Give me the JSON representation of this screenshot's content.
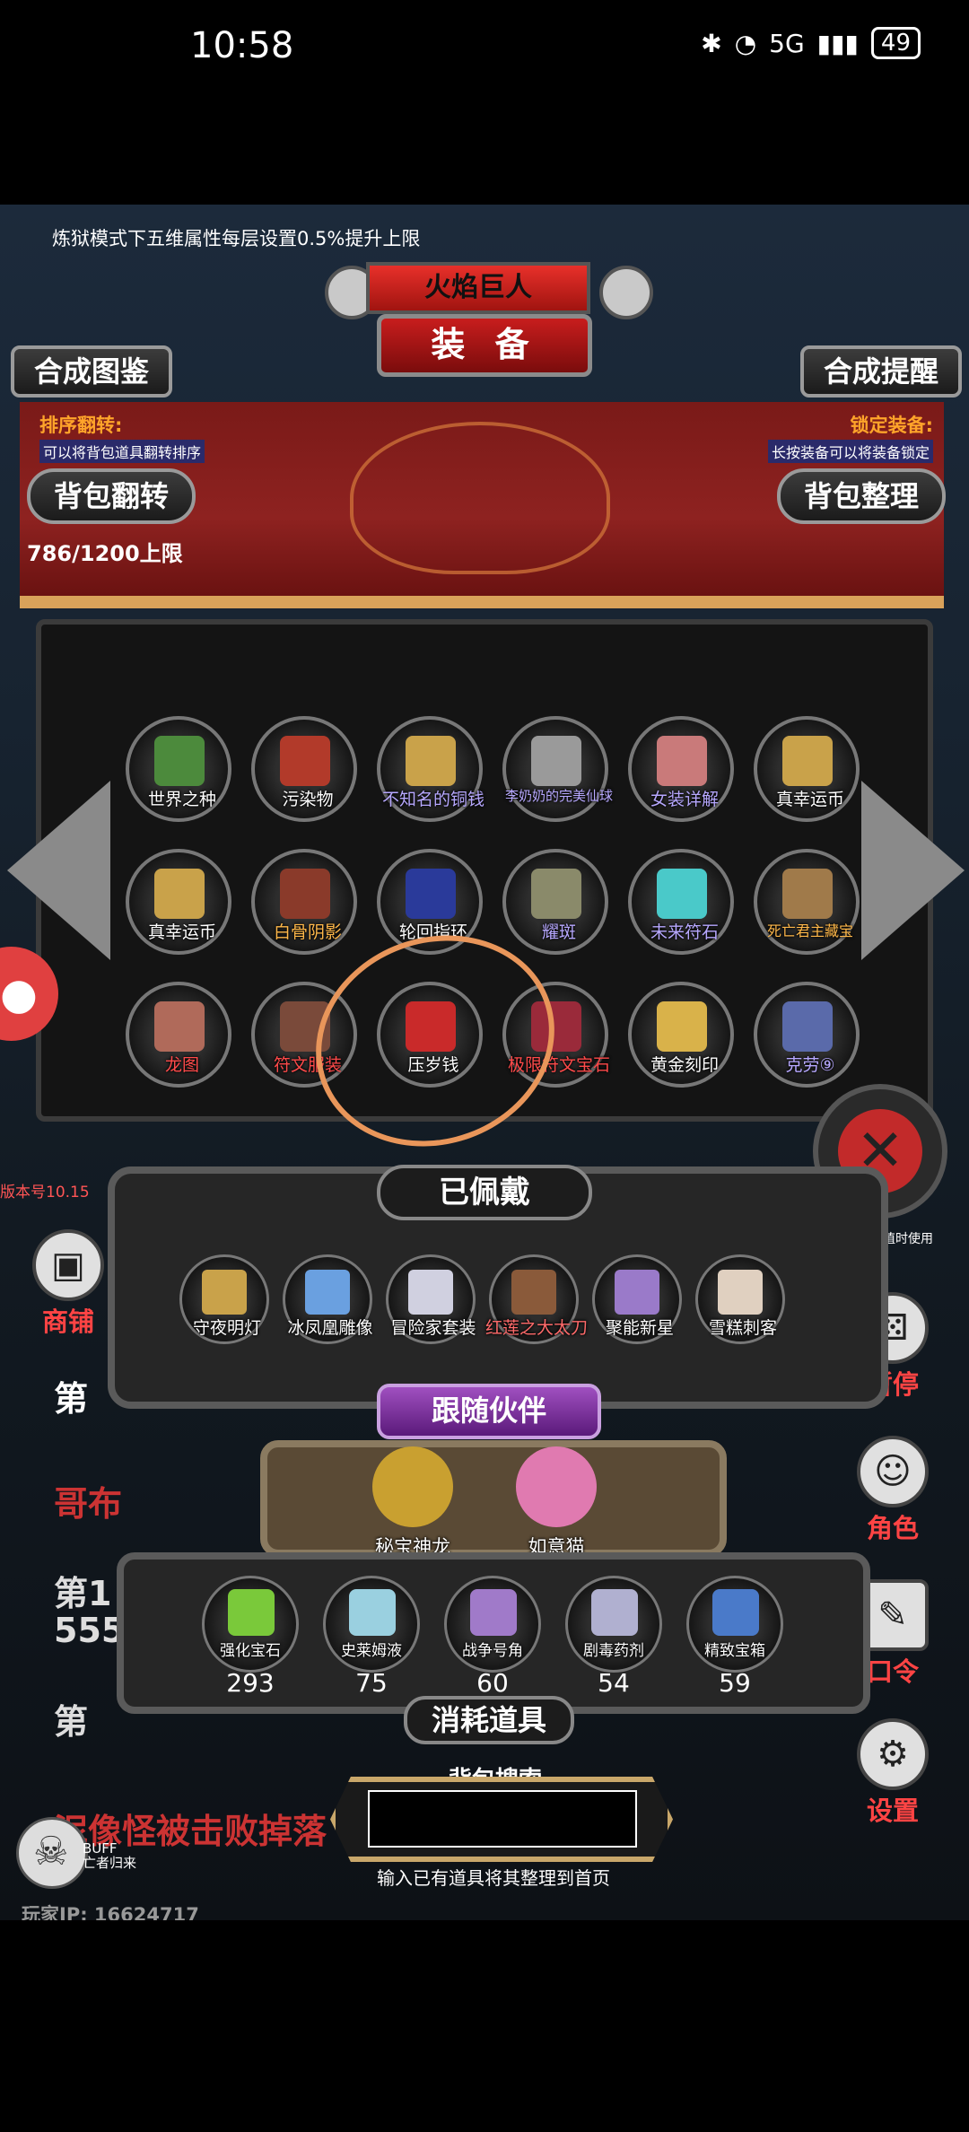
{
  "status_bar": {
    "time": "10:58",
    "network": "5G",
    "battery": "49"
  },
  "notice": "炼狱模式下五维属性每层设置0.5%提升上限",
  "header": {
    "boss_name": "火焰巨人",
    "title": "装 备"
  },
  "buttons": {
    "combine_album": "合成图鉴",
    "combine_tip": "合成提醒",
    "bag_flip": "背包翻转",
    "bag_tidy": "背包整理"
  },
  "sort_info": {
    "title": "排序翻转:",
    "desc": "可以将背包道具翻转排序"
  },
  "lock_info": {
    "title": "锁定装备:",
    "desc": "长按装备可以将装备锁定"
  },
  "capacity": "786/1200上限",
  "inventory": [
    {
      "label": "世界之种",
      "color": "#4c8a3c",
      "label_color": "#ffffff"
    },
    {
      "label": "污染物",
      "color": "#b23a2a",
      "label_color": "#ffffff"
    },
    {
      "label": "不知名的铜钱",
      "color": "#c9a24a",
      "label_color": "#b7a8ff"
    },
    {
      "label": "李奶奶的完美仙球",
      "color": "#9a9a9a",
      "label_color": "#b7a8ff"
    },
    {
      "label": "女装详解",
      "color": "#c97a7a",
      "label_color": "#b7a8ff"
    },
    {
      "label": "真幸运币",
      "color": "#c9a24a",
      "label_color": "#ffffff"
    },
    {
      "label": "真幸运币",
      "color": "#c9a24a",
      "label_color": "#ffffff"
    },
    {
      "label": "白骨阴影",
      "color": "#8a3a2a",
      "label_color": "#ffb84a"
    },
    {
      "label": "轮回指环",
      "color": "#2a3a9a",
      "label_color": "#ffffff"
    },
    {
      "label": "耀斑",
      "color": "#8a8a6a",
      "label_color": "#b7a8ff"
    },
    {
      "label": "未来符石",
      "color": "#4ac9c9",
      "label_color": "#b7a8ff"
    },
    {
      "label": "死亡君主藏宝",
      "color": "#a07a4a",
      "label_color": "#ffb84a"
    },
    {
      "label": "龙图",
      "color": "#b06a5a",
      "label_color": "#ff4a4a"
    },
    {
      "label": "符文服装",
      "color": "#7a4a3a",
      "label_color": "#ff4a4a"
    },
    {
      "label": "压岁钱",
      "color": "#c92a2a",
      "label_color": "#ffffff"
    },
    {
      "label": "极限符文宝石",
      "color": "#9a2a3a",
      "label_color": "#ff4a4a"
    },
    {
      "label": "黄金刻印",
      "color": "#d9b24a",
      "label_color": "#ffffff"
    },
    {
      "label": "克劳⑨",
      "color": "#5a6aaa",
      "label_color": "#b7a8ff"
    }
  ],
  "version": "版本号10.15",
  "equipped": {
    "title": "已佩戴",
    "items": [
      {
        "label": "守夜明灯",
        "color": "#c9a24a"
      },
      {
        "label": "冰凤凰雕像",
        "color": "#6aa0e0"
      },
      {
        "label": "冒险家套装",
        "color": "#d0d0e0"
      },
      {
        "label": "红莲之大太刀",
        "color": "#8a5a3a"
      },
      {
        "label": "聚能新星",
        "color": "#9a7ac9"
      },
      {
        "label": "雪糕刺客",
        "color": "#e0d0c0"
      }
    ]
  },
  "companion": {
    "title": "跟随伙伴",
    "items": [
      {
        "label": "秘宝神龙",
        "color": "#c9a030"
      },
      {
        "label": "如意猫",
        "color": "#e07ab0"
      }
    ]
  },
  "consumables": {
    "title": "消耗道具",
    "items": [
      {
        "label": "强化宝石",
        "count": "293",
        "color": "#7ac93a"
      },
      {
        "label": "史莱姆液",
        "count": "75",
        "color": "#9ad0e0"
      },
      {
        "label": "战争号角",
        "count": "60",
        "color": "#a07ac9"
      },
      {
        "label": "剧毒药剂",
        "count": "54",
        "color": "#b0b0d0"
      },
      {
        "label": "精致宝箱",
        "count": "59",
        "color": "#4a7ac9"
      }
    ]
  },
  "search": {
    "label": "背包搜索",
    "value": "",
    "hint": "输入已有道具将其整理到首页"
  },
  "side": {
    "shop": "商铺",
    "pause": "暂停",
    "role": "角色",
    "code": "口令",
    "settings": "设置",
    "value_fragment": "其数值时使用"
  },
  "buff": {
    "label": "BUFF",
    "sub": "亡者归来"
  },
  "player_ip": "玩家IP: 16624717",
  "background_text": {
    "line1": "第",
    "line2": "哥布",
    "line3a": "第1",
    "line3b": "555",
    "line4": "第",
    "line5": "泥像怪被击败掉落"
  }
}
